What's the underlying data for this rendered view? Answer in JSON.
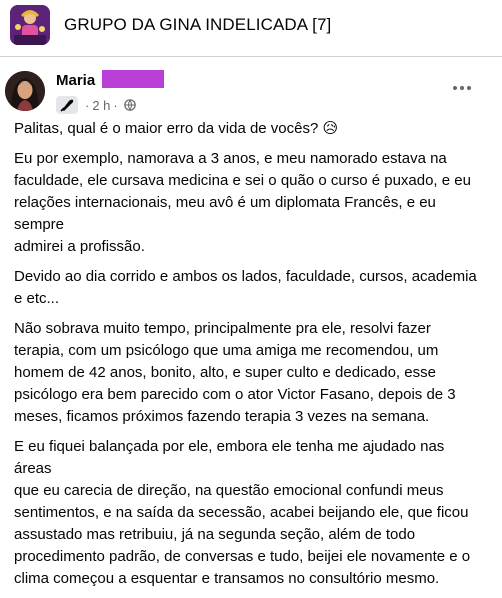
{
  "group": {
    "title": "GRUPO DA GINA INDELICADA [7]"
  },
  "post": {
    "author": "Maria",
    "timestamp": "2 h",
    "separator": "·",
    "paragraphs": [
      "Palitas, qual é o maior erro da vida de vocês? 😥",
      "Eu por exemplo, namorava a 3 anos, e meu namorado estava na\nfaculdade, ele cursava medicina e sei o quão o curso é puxado, e eu\nrelações internacionais, meu avô é um diplomata Francês, e eu sempre\nadmirei a profissão.",
      "Devido ao dia corrido e ambos os lados, faculdade, cursos, academia\ne etc...",
      "Não sobrava muito tempo, principalmente pra ele, resolvi fazer\nterapia, com um psicólogo que uma amiga me recomendou, um\nhomem de 42 anos, bonito, alto, e super culto e dedicado, esse\npsicólogo era bem parecido com o ator Victor Fasano, depois de 3\nmeses, ficamos próximos fazendo terapia 3 vezes na semana.",
      "E eu fiquei balançada por ele, embora ele tenha me ajudado nas áreas\nque eu carecia de direção, na questão emocional confundi meus\nsentimentos, e na saída da secessão, acabei beijando ele, que ficou\nassustado mas retribuiu, já na segunda seção, além de todo\nprocedimento padrão, de conversas e tudo, beijei ele novamente e o\nclima começou a esquentar e transamos no consultório mesmo."
    ]
  },
  "icons": {
    "group_avatar": "group-avatar-image",
    "author_avatar": "profile-photo",
    "badge": "quill-pen-icon",
    "audience": "globe-icon",
    "more": "more-options-icon"
  },
  "colors": {
    "redaction": "#b93fd6",
    "secondary_text": "#65676b",
    "badge_bg": "#e4e6eb"
  }
}
